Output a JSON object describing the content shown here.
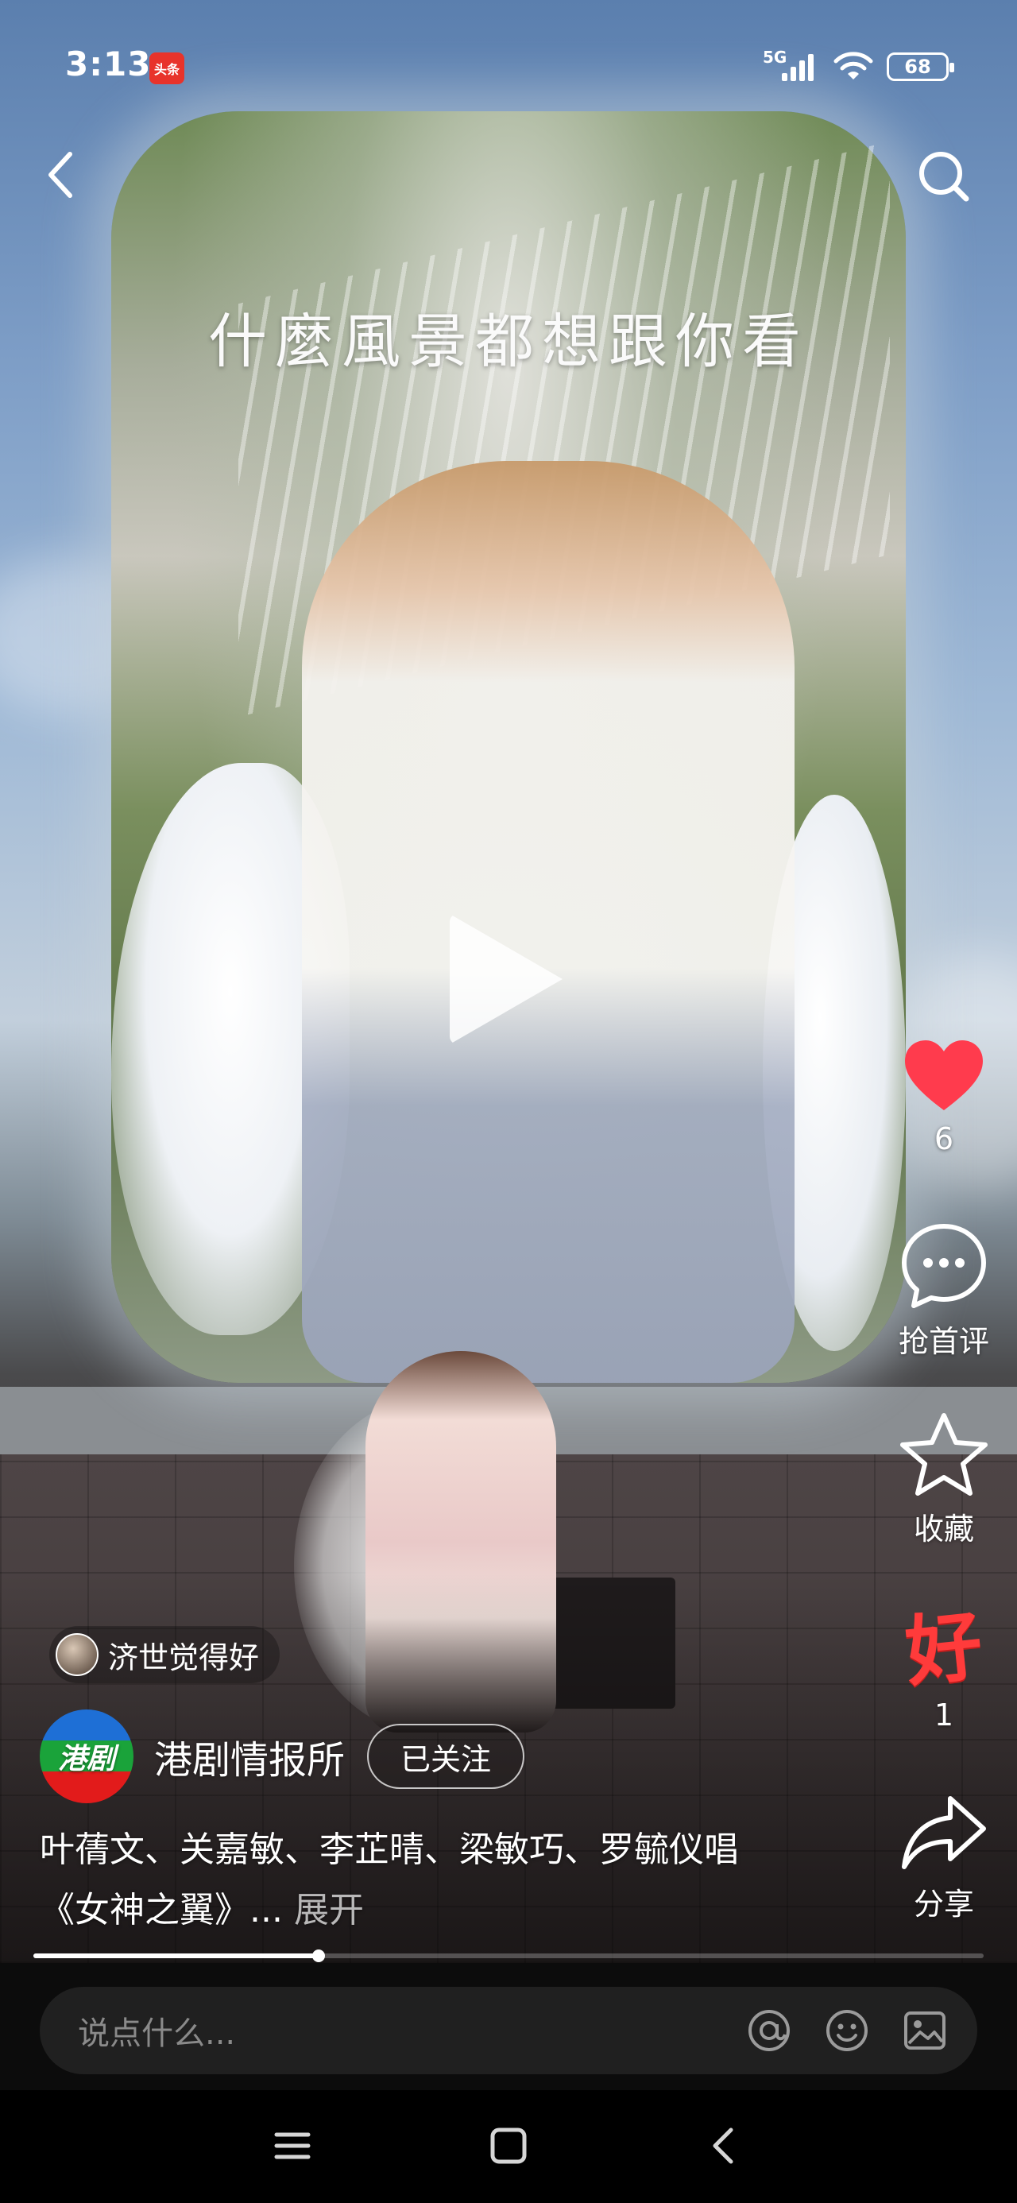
{
  "status_bar": {
    "time": "3:13",
    "app_badge": "头条",
    "network": "5G",
    "battery": "68"
  },
  "video": {
    "overlay_caption": "什麼風景都想跟你看"
  },
  "actions": {
    "like_count": "6",
    "comment_label": "抢首评",
    "favorite_label": "收藏",
    "good_label": "好",
    "good_count": "1",
    "share_label": "分享",
    "like_color": "#ff3b4d"
  },
  "mention": {
    "name": "济世觉得好"
  },
  "author": {
    "avatar_text": "港剧",
    "name": "港剧情报所",
    "follow_label": "已关注"
  },
  "description": {
    "line1": "叶蒨文、关嘉敏、李芷晴、梁敏巧、罗毓仪唱",
    "line2": "《女神之翼》...",
    "expand": "展开"
  },
  "progress": {
    "fraction": 0.3
  },
  "comment": {
    "placeholder": "说点什么..."
  },
  "icons": {
    "back": "back-arrow-icon",
    "search": "search-icon",
    "like": "heart-icon",
    "comment": "comment-bubble-icon",
    "favorite": "star-icon",
    "share": "share-arrow-icon",
    "mention": "at-icon",
    "emoji": "emoji-icon",
    "image": "image-icon"
  }
}
